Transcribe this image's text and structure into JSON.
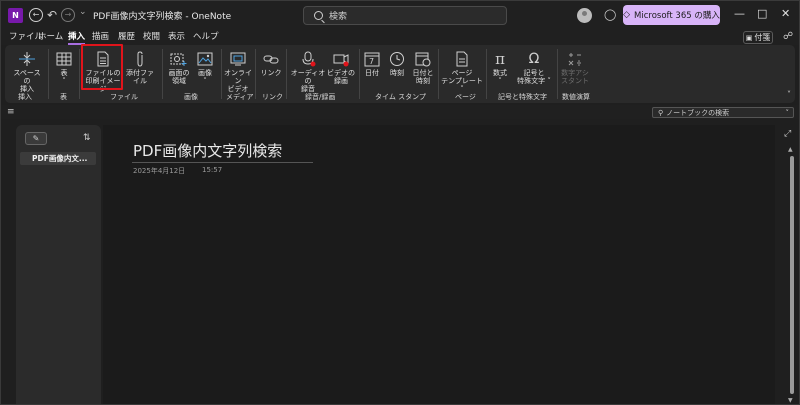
{
  "titlebar": {
    "app_icon": "N",
    "title": "PDF画像内文字列検索  -  OneNote",
    "search_placeholder": "検索",
    "ms365_label": "Microsoft 365 の購入"
  },
  "menu": {
    "tabs": [
      "ファイル",
      "ホーム",
      "挿入",
      "描画",
      "履歴",
      "校閲",
      "表示",
      "ヘルプ"
    ],
    "active_tab": "挿入",
    "sticky_label": "付箋"
  },
  "ribbon": {
    "space_btn": [
      "スペースの",
      "挿入"
    ],
    "table_btn": [
      "表"
    ],
    "printout_btn": [
      "ファイルの",
      "印刷イメージ"
    ],
    "attach_btn": [
      "添付ファイル"
    ],
    "screenclip_btn": [
      "画面の",
      "領域"
    ],
    "picture_btn": [
      "画像"
    ],
    "onlinevideo_btn": [
      "オンライン",
      "ビデオ"
    ],
    "link_btn": [
      "リンク"
    ],
    "audio_btn": [
      "オーディオの",
      "録音"
    ],
    "video_btn": [
      "ビデオの",
      "録画"
    ],
    "date_btn": [
      "日付"
    ],
    "time_btn": [
      "時刻"
    ],
    "datetime_btn": [
      "日付と",
      "時刻"
    ],
    "template_btn": [
      "ページ",
      "テンプレート"
    ],
    "equation_btn": [
      "数式"
    ],
    "symbol_btn": [
      "記号と",
      "特殊文字"
    ],
    "mathstamp_btn": [
      "数字アシ",
      "スタント"
    ],
    "groups": {
      "insert": "挿入",
      "tables": "表",
      "files": "ファイル",
      "images": "画像",
      "media": "メディア",
      "links": "リンク",
      "recording": "録音/録画",
      "timestamp": "タイム スタンプ",
      "pages": "ページ",
      "symbols": "記号と特殊文字",
      "math": "数値演算"
    }
  },
  "notebook_search": "ノートブックの検索",
  "pages": {
    "items": [
      "PDF画像内文..."
    ]
  },
  "page": {
    "title": "PDF画像内文字列検索",
    "date": "2025年4月12日",
    "time": "15:57"
  },
  "colors": {
    "accent": "#a86ee0",
    "highlight_box": "#e0141b",
    "ms365_bg": "#d8b4f8",
    "app_purple": "#7719aa"
  }
}
